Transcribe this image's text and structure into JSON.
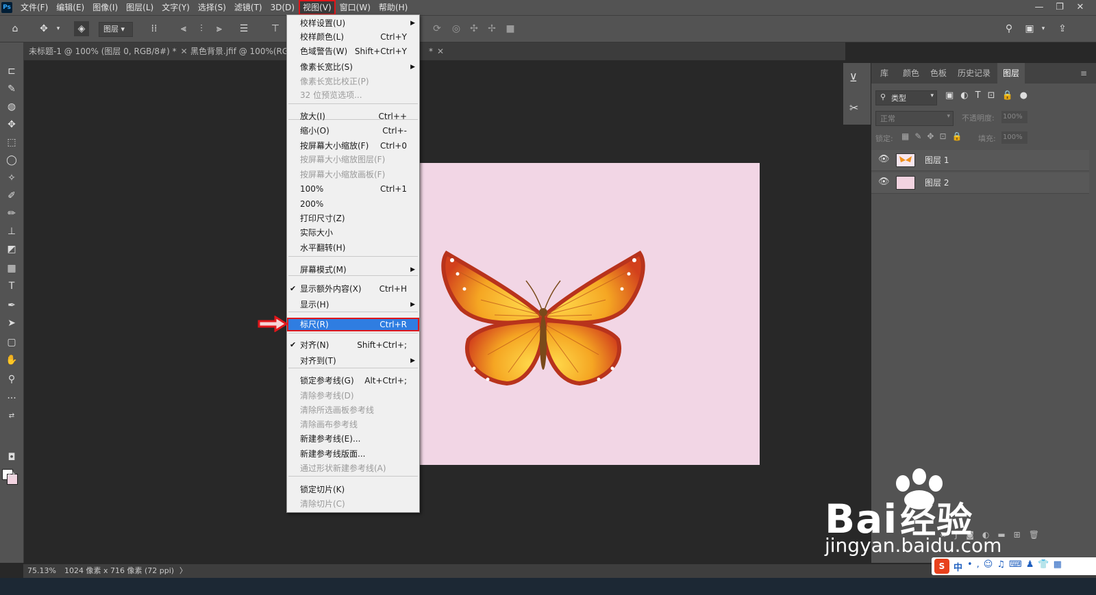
{
  "colors": {
    "accent": "#2f7de1",
    "highlight_red": "#e0161a",
    "canvas_pink": "#f2d6e5"
  },
  "menubar": {
    "logo": "Ps",
    "items": [
      "文件(F)",
      "编辑(E)",
      "图像(I)",
      "图层(L)",
      "文字(Y)",
      "选择(S)",
      "滤镜(T)",
      "3D(D)",
      "视图(V)",
      "窗口(W)",
      "帮助(H)"
    ],
    "active": "视图(V)"
  },
  "options_bar": {
    "layer_select": "图层"
  },
  "tabs": [
    {
      "label": "未标题-1 @ 100% (图层 0, RGB/8#) *"
    },
    {
      "label": "黑色背景.jfif @ 100%(RGB"
    },
    {
      "label": "*"
    }
  ],
  "view_menu": {
    "items": [
      {
        "label": "校样设置(U)",
        "shortcut": "",
        "submenu": true
      },
      {
        "label": "校样颜色(L)",
        "shortcut": "Ctrl+Y"
      },
      {
        "label": "色域警告(W)",
        "shortcut": "Shift+Ctrl+Y"
      },
      {
        "label": "像素长宽比(S)",
        "shortcut": "",
        "submenu": true
      },
      {
        "label": "像素长宽比校正(P)",
        "shortcut": "",
        "disabled": true
      },
      {
        "label": "32 位预览选项...",
        "shortcut": "",
        "disabled": true
      },
      {
        "label": "放大(I)",
        "shortcut": "Ctrl++"
      },
      {
        "label": "缩小(O)",
        "shortcut": "Ctrl+-"
      },
      {
        "label": "按屏幕大小缩放(F)",
        "shortcut": "Ctrl+0"
      },
      {
        "label": "按屏幕大小缩放图层(F)",
        "shortcut": "",
        "disabled": true
      },
      {
        "label": "按屏幕大小缩放画板(F)",
        "shortcut": "",
        "disabled": true
      },
      {
        "label": "100%",
        "shortcut": "Ctrl+1"
      },
      {
        "label": "200%",
        "shortcut": ""
      },
      {
        "label": "打印尺寸(Z)",
        "shortcut": ""
      },
      {
        "label": "实际大小",
        "shortcut": ""
      },
      {
        "label": "水平翻转(H)",
        "shortcut": ""
      },
      {
        "label": "屏幕模式(M)",
        "shortcut": "",
        "submenu": true
      },
      {
        "label": "显示额外内容(X)",
        "shortcut": "Ctrl+H",
        "checked": true
      },
      {
        "label": "显示(H)",
        "shortcut": "",
        "submenu": true
      },
      {
        "label": "标尺(R)",
        "shortcut": "Ctrl+R",
        "highlighted": true
      },
      {
        "label": "对齐(N)",
        "shortcut": "Shift+Ctrl+;",
        "checked": true
      },
      {
        "label": "对齐到(T)",
        "shortcut": "",
        "submenu": true
      },
      {
        "label": "锁定参考线(G)",
        "shortcut": "Alt+Ctrl+;"
      },
      {
        "label": "清除参考线(D)",
        "shortcut": "",
        "disabled": true
      },
      {
        "label": "清除所选画板参考线",
        "shortcut": "",
        "disabled": true
      },
      {
        "label": "清除画布参考线",
        "shortcut": "",
        "disabled": true
      },
      {
        "label": "新建参考线(E)...",
        "shortcut": ""
      },
      {
        "label": "新建参考线版面...",
        "shortcut": ""
      },
      {
        "label": "通过形状新建参考线(A)",
        "shortcut": "",
        "disabled": true
      },
      {
        "label": "锁定切片(K)",
        "shortcut": ""
      },
      {
        "label": "清除切片(C)",
        "shortcut": "",
        "disabled": true
      }
    ]
  },
  "panels": {
    "tabs": [
      "库",
      "颜色",
      "色板",
      "历史记录",
      "图层"
    ],
    "active_tab": "图层",
    "filter_label": "类型",
    "blend_mode": "正常",
    "opacity_label": "不透明度:",
    "opacity_value": "100%",
    "lock_label": "锁定:",
    "fill_label": "填充:",
    "fill_value": "100%",
    "layers": [
      {
        "name": "图层 1",
        "thumb": "butterfly"
      },
      {
        "name": "图层 2",
        "thumb": "pink"
      }
    ]
  },
  "status": {
    "zoom": "75.13%",
    "doc_info": "1024 像素 x 716 像素 (72 ppi)",
    "more": "〉"
  },
  "watermark": {
    "brand": "Bai",
    "brand_cn": "经验",
    "url": "jingyan.baidu.com"
  },
  "tray": {
    "ime": "中"
  }
}
